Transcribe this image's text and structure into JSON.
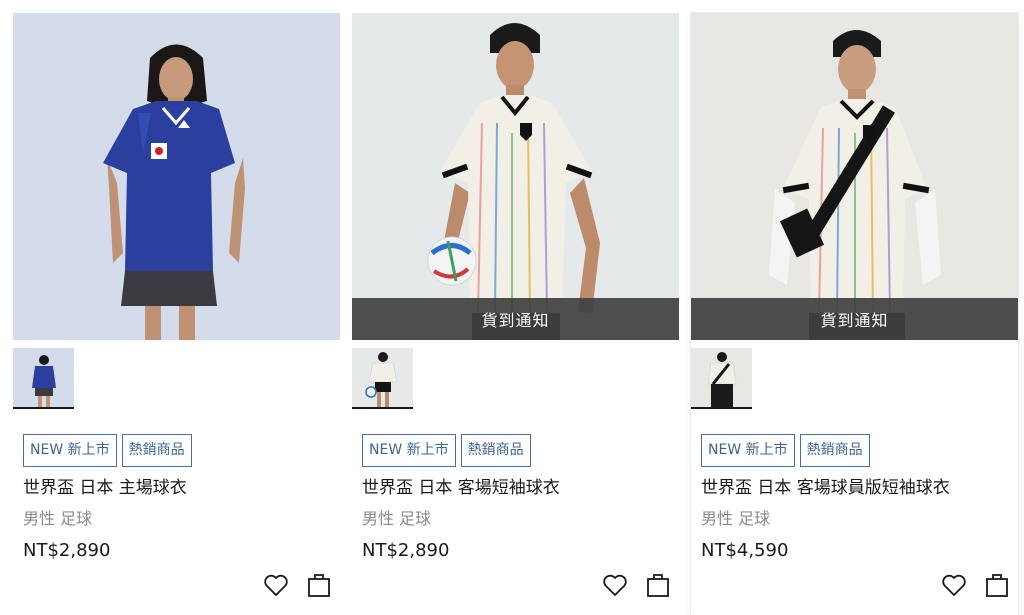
{
  "products": [
    {
      "image_alt": "Model wearing blue Japan home jersey",
      "badges": [
        "NEW 新上市",
        "熱銷商品"
      ],
      "name": "世界盃 日本 主場球衣",
      "category": "男性 足球",
      "price": "NT$2,890",
      "notify_label": ""
    },
    {
      "image_alt": "Model wearing white Japan away jersey with football",
      "badges": [
        "NEW 新上市",
        "熱銷商品"
      ],
      "name": "世界盃 日本 客場短袖球衣",
      "category": "男性 足球",
      "price": "NT$2,890",
      "notify_label": "貨到通知"
    },
    {
      "image_alt": "Model wearing white Japan authentic away jersey with sling bag",
      "badges": [
        "NEW 新上市",
        "熱銷商品"
      ],
      "name": "世界盃 日本 客場球員版短袖球衣",
      "category": "男性 足球",
      "price": "NT$4,590",
      "notify_label": "貨到通知"
    }
  ],
  "icons": {
    "wishlist": "heart-icon",
    "cart": "shopping-bag-icon"
  },
  "colors": {
    "badge_border": "#4a6f9a",
    "badge_text": "#3d6593",
    "overlay": "#404040",
    "home_kit": "#2a3f9e"
  }
}
